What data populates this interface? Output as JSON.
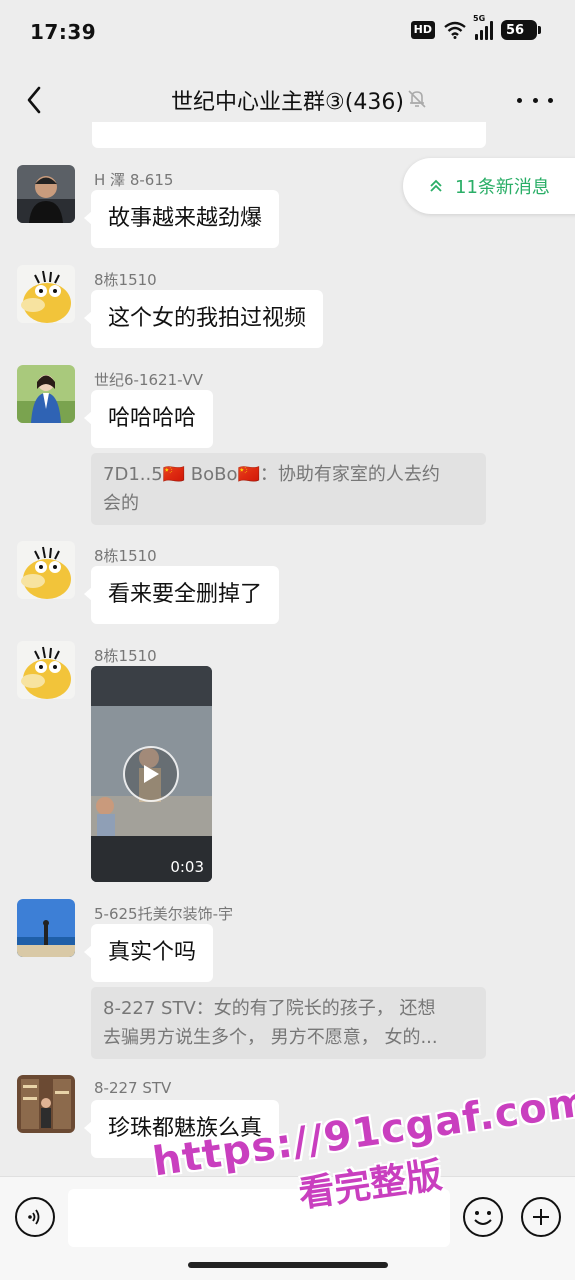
{
  "status_bar": {
    "time": "17:39",
    "hd": "HD",
    "network": "5G",
    "battery": "56"
  },
  "header": {
    "title": "世纪中心业主群③(436)"
  },
  "new_messages": {
    "label": "11条新消息"
  },
  "messages": [
    {
      "sender": "H 澤 8-615",
      "text": "故事越来越劲爆"
    },
    {
      "sender": "8栋1510",
      "text": "这个女的我拍过视频"
    },
    {
      "sender": "世纪6-1621-VV",
      "text": "哈哈哈哈",
      "quote": [
        "7D1..5🇨🇳 BoBo🇨🇳：协助有家室的人去约",
        "会的"
      ]
    },
    {
      "sender": "8栋1510",
      "text": "看来要全删掉了"
    },
    {
      "sender": "8栋1510",
      "video_duration": "0:03"
    },
    {
      "sender": "5-625托美尔装饰-宇",
      "text": "真实个吗",
      "quote": [
        "8-227 STV：女的有了院长的孩子， 还想",
        "去骗男方说生多个， 男方不愿意， 女的..."
      ]
    },
    {
      "sender": "8-227 STV",
      "text": "珍珠都魅族么真"
    }
  ],
  "watermark": {
    "url": "https://91cgaf.com",
    "subtitle": "看完整版"
  },
  "colors": {
    "accent_green": "#2aae67",
    "watermark": "#c93fbf",
    "background": "#ededed"
  }
}
